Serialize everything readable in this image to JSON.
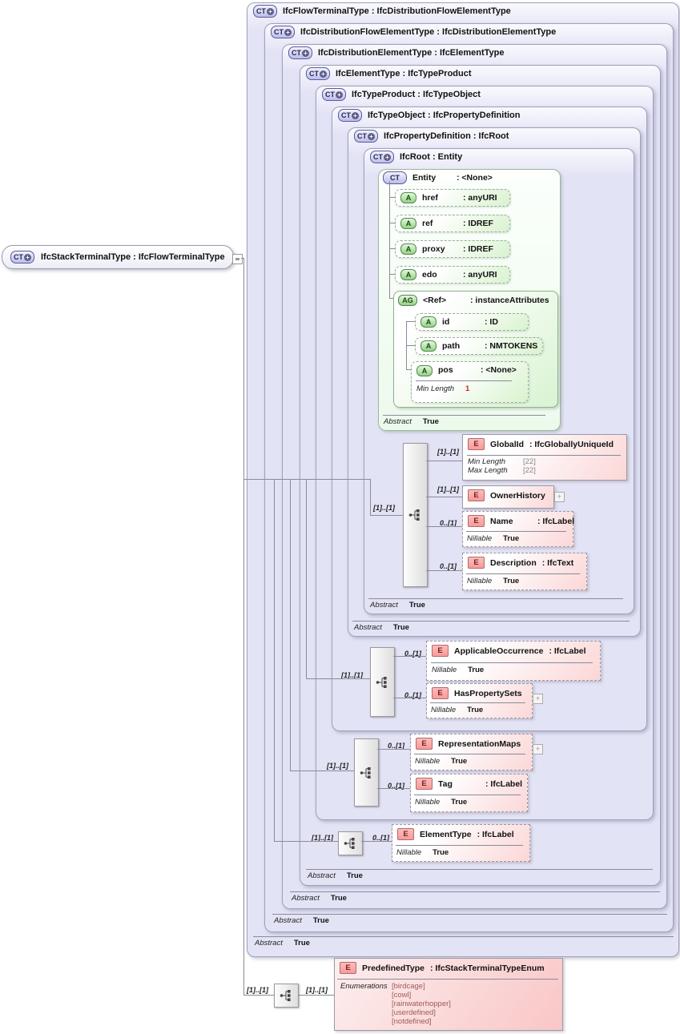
{
  "badges": {
    "ct": "CT",
    "a": "A",
    "ag": "AG",
    "e": "E",
    "plus": "+"
  },
  "root": {
    "title": "IfcStackTerminalType : IfcFlowTerminalType"
  },
  "nested": [
    {
      "title": "IfcFlowTerminalType : IfcDistributionFlowElementType",
      "facet_name": "Abstract",
      "facet_value": "True"
    },
    {
      "title": "IfcDistributionFlowElementType : IfcDistributionElementType",
      "facet_name": "Abstract",
      "facet_value": "True"
    },
    {
      "title": "IfcDistributionElementType : IfcElementType",
      "facet_name": "Abstract",
      "facet_value": "True"
    },
    {
      "title": "IfcElementType : IfcTypeProduct",
      "facet_name": "Abstract",
      "facet_value": "True"
    },
    {
      "title": "IfcTypeProduct : IfcTypeObject"
    },
    {
      "title": "IfcTypeObject : IfcPropertyDefinition"
    },
    {
      "title": "IfcPropertyDefinition : IfcRoot",
      "facet_name": "Abstract",
      "facet_value": "True"
    },
    {
      "title": "IfcRoot : Entity",
      "facet_name": "Abstract",
      "facet_value": "True"
    }
  ],
  "entity": {
    "name": "Entity",
    "type": ": <None>",
    "facet_name": "Abstract",
    "facet_value": "True",
    "attrs": [
      {
        "name": "href",
        "type": ": anyURI"
      },
      {
        "name": "ref",
        "type": ": IDREF"
      },
      {
        "name": "proxy",
        "type": ": IDREF"
      },
      {
        "name": "edo",
        "type": ": anyURI"
      }
    ],
    "group": {
      "name": "<Ref>",
      "type": ": instanceAttributes",
      "attrs": [
        {
          "name": "id",
          "type": ": ID"
        },
        {
          "name": "path",
          "type": ": NMTOKENS"
        },
        {
          "name": "pos",
          "type": ": <None>",
          "facet_name": "Min Length",
          "facet_value": "1"
        }
      ]
    }
  },
  "groups": {
    "ifcroot": {
      "card": "[1]..[1]",
      "items": [
        {
          "card": "[1]..[1]",
          "name": "GlobalId",
          "type": ": IfcGloballyUniqueId",
          "facets": [
            {
              "n": "Min Length",
              "v": "[22]"
            },
            {
              "n": "Max Length",
              "v": "[22]"
            }
          ]
        },
        {
          "card": "[1]..[1]",
          "name": "OwnerHistory",
          "type": ""
        },
        {
          "card": "0..[1]",
          "name": "Name",
          "type": ": IfcLabel",
          "facets": [
            {
              "n": "Nillable",
              "v": "True"
            }
          ]
        },
        {
          "card": "0..[1]",
          "name": "Description",
          "type": ": IfcText",
          "facets": [
            {
              "n": "Nillable",
              "v": "True"
            }
          ]
        }
      ]
    },
    "ifctypeobject": {
      "card": "[1]..[1]",
      "items": [
        {
          "card": "0..[1]",
          "name": "ApplicableOccurrence",
          "type": ": IfcLabel",
          "facets": [
            {
              "n": "Nillable",
              "v": "True"
            }
          ]
        },
        {
          "card": "0..[1]",
          "name": "HasPropertySets",
          "type": "",
          "facets": [
            {
              "n": "Nillable",
              "v": "True"
            }
          ]
        }
      ]
    },
    "ifctypeproduct": {
      "card": "[1]..[1]",
      "items": [
        {
          "card": "0..[1]",
          "name": "RepresentationMaps",
          "type": "",
          "facets": [
            {
              "n": "Nillable",
              "v": "True"
            }
          ]
        },
        {
          "card": "0..[1]",
          "name": "Tag",
          "type": ": IfcLabel",
          "facets": [
            {
              "n": "Nillable",
              "v": "True"
            }
          ]
        }
      ]
    },
    "ifcelementtype": {
      "card": "[1]..[1]",
      "items": [
        {
          "card": "0..[1]",
          "name": "ElementType",
          "type": ": IfcLabel",
          "facets": [
            {
              "n": "Nillable",
              "v": "True"
            }
          ]
        }
      ]
    },
    "predefined": {
      "card_left": "[1]..[1]",
      "card_right": "[1]..[1]",
      "item": {
        "name": "PredefinedType",
        "type": ": IfcStackTerminalTypeEnum",
        "facet_name": "Enumerations",
        "values": [
          "[birdcage]",
          "[cowl]",
          "[rainwaterhopper]",
          "[userdefined]",
          "[notdefined]"
        ]
      }
    }
  }
}
